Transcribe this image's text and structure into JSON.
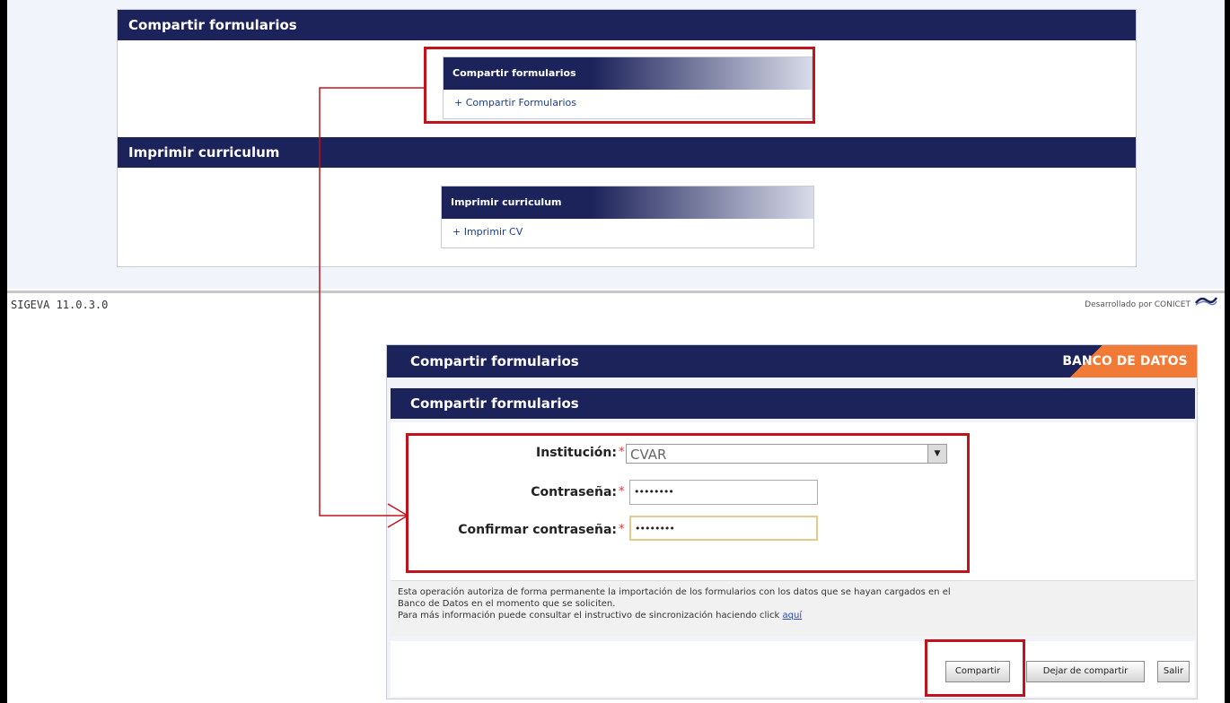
{
  "top": {
    "share_section": {
      "title": "Compartir formularios",
      "box_title": "Compartir formularios",
      "link": "+ Compartir Formularios"
    },
    "print_section": {
      "title": "Imprimir curriculum",
      "box_title": "Imprimir curriculum",
      "link": "+ Imprimir CV"
    }
  },
  "footer": {
    "version": "SIGEVA 11.0.3.0",
    "credit": "Desarrollado por CONICET"
  },
  "dialog": {
    "title": "Compartir formularios",
    "brand": "BANCO DE DATOS",
    "subtitle": "Compartir formularios",
    "fields": {
      "institution_label": "Institución:",
      "institution_value": "CVAR",
      "password_label": "Contraseña:",
      "password_value": "••••••••",
      "confirm_label": "Confirmar contraseña:",
      "confirm_value": "••••••••",
      "required_mark": "*"
    },
    "info": {
      "line1": "Esta operación autoriza de forma permanente la importación de los formularios con los datos que se hayan cargados en el",
      "line2": "Banco de Datos en el momento que se soliciten.",
      "line3": "Para más información puede consultar el instructivo de sincronización haciendo click",
      "link": "aquí"
    },
    "buttons": {
      "share": "Compartir",
      "unshare": "Dejar de compartir",
      "exit": "Salir"
    }
  },
  "colors": {
    "navy": "#1c225a",
    "highlight_red": "#c0131b",
    "brand_orange": "#f07a36"
  }
}
